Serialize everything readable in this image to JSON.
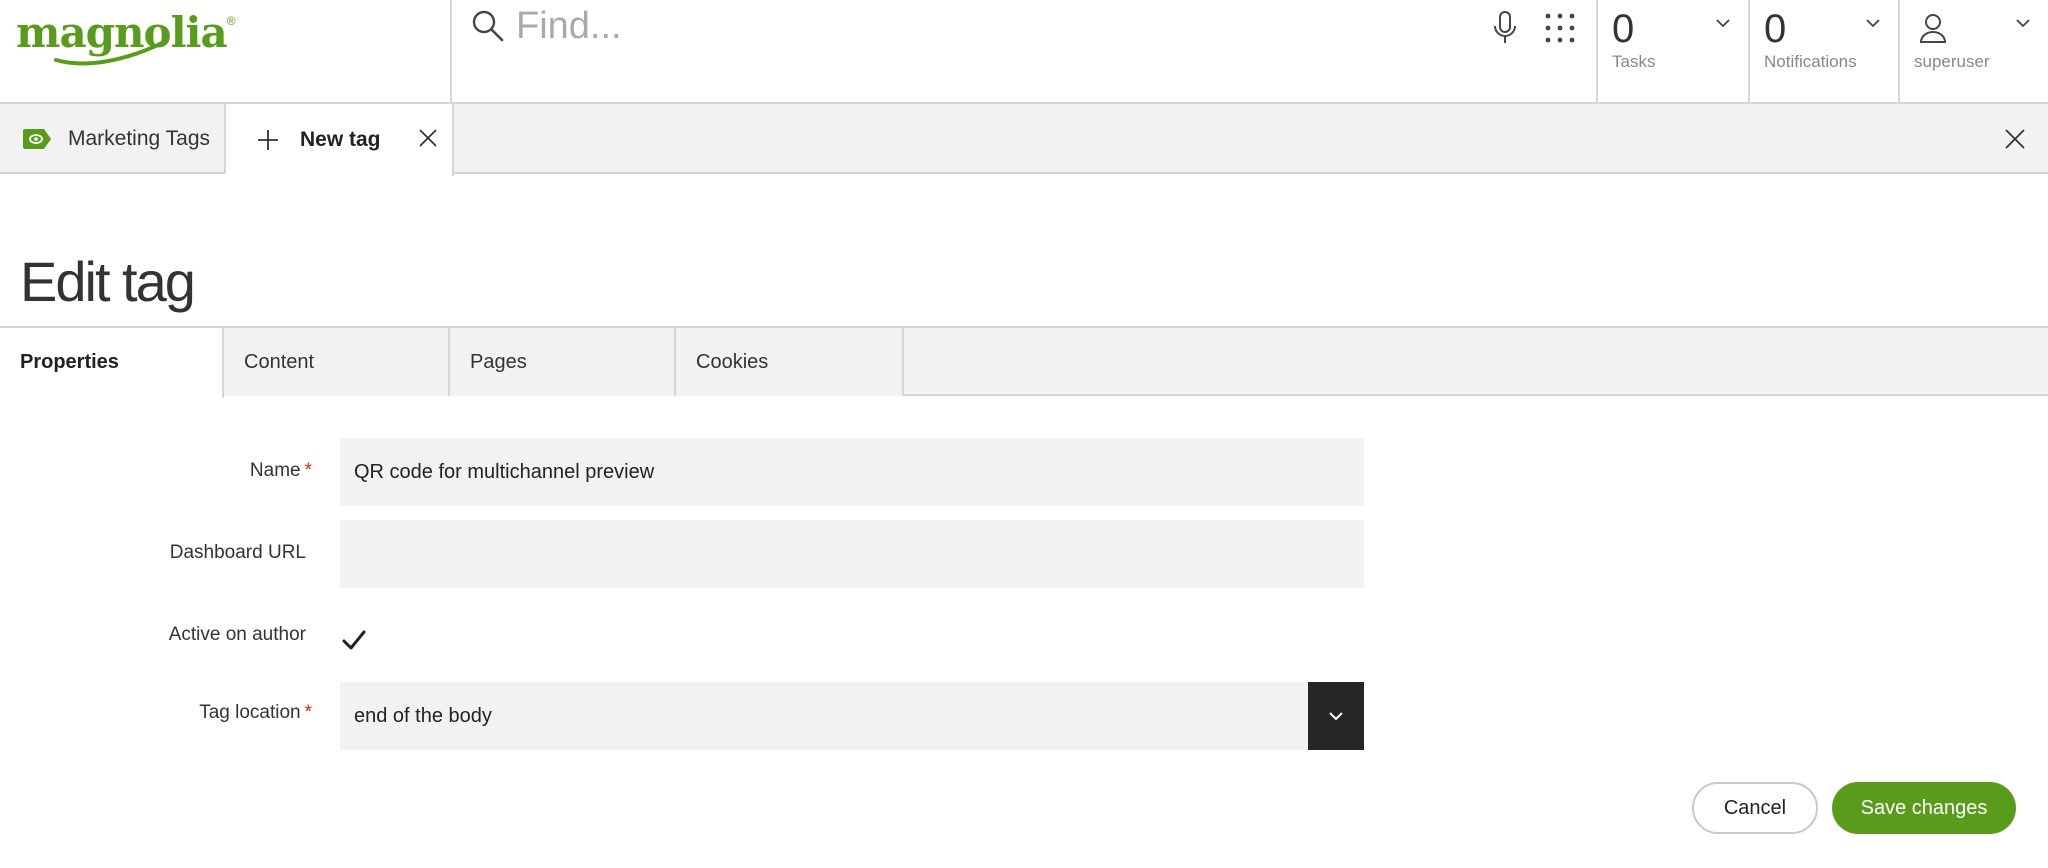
{
  "brand": {
    "name": "magnolia",
    "mark": "®",
    "accent": "#599c1c"
  },
  "search": {
    "placeholder": "Find..."
  },
  "header": {
    "tasks": {
      "count": "0",
      "label": "Tasks"
    },
    "notifications": {
      "count": "0",
      "label": "Notifications"
    },
    "user": {
      "name": "superuser"
    }
  },
  "app_tabs": {
    "marketing": "Marketing Tags",
    "new_tag": "New tag"
  },
  "page": {
    "title": "Edit tag"
  },
  "sub_tabs": [
    "Properties",
    "Content",
    "Pages",
    "Cookies"
  ],
  "form": {
    "name": {
      "label": "Name",
      "required_mark": "*",
      "value": "QR code for multichannel preview"
    },
    "dashboard_url": {
      "label": "Dashboard URL",
      "value": ""
    },
    "active_on_author": {
      "label": "Active on author",
      "checked": true
    },
    "tag_location": {
      "label": "Tag location",
      "required_mark": "*",
      "value": "end of the body"
    }
  },
  "actions": {
    "cancel": "Cancel",
    "save": "Save changes"
  },
  "colors": {
    "required": "#e2231a",
    "primary": "#599c1c",
    "select_button": "#262626"
  }
}
